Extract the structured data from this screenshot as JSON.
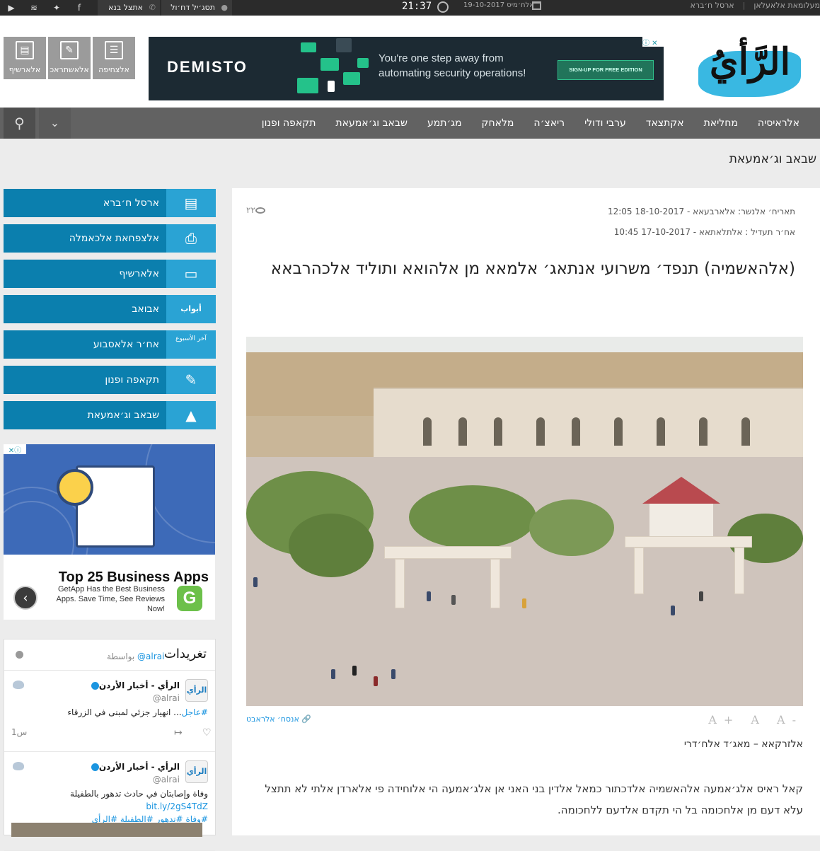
{
  "topbar": {
    "social_icons": [
      "youtube-icon",
      "rss-icon",
      "twitter-icon",
      "facebook-icon"
    ],
    "contact_label": "אתצל בנא",
    "login_label": "תסג׳יל דח׳ול",
    "time": "21:37",
    "date": "אלח׳מיס 19-10-2017",
    "links": [
      "ארסל ח׳ברא",
      "מעלומאת אלאעלאן"
    ]
  },
  "header": {
    "quick_links": [
      "אלצחיפה",
      "אלאשתראכ",
      "אלארשיף"
    ],
    "logo_text": "الرَّأيُ",
    "ad": {
      "brand": "DEMISTO",
      "message_line1": "You're one step away from",
      "message_line2": "automating security operations!",
      "cta": "SIGN-UP FOR FREE EDITION"
    }
  },
  "nav": {
    "items": [
      "אלראיסיה",
      "מחליאת",
      "אקתצאד",
      "ערבי ודולי",
      "ריאצ׳ה",
      "מלאחק",
      "מג׳תמע",
      "שבאב וג׳אמעאת",
      "תקאפה ופנון"
    ]
  },
  "section": {
    "title": "שבאב וג׳אמעאת"
  },
  "sidebar": {
    "items": [
      {
        "label": "ארסל ח׳ברא",
        "icon": "newspaper-icon"
      },
      {
        "label": "אלצפחאת אלכאמלה",
        "icon": "pdf-icon"
      },
      {
        "label": "אלארשיף",
        "icon": "archive-icon"
      },
      {
        "label": "אבואב",
        "icon": "abwab-icon",
        "badge": "أبواب"
      },
      {
        "label": "אח׳ר אלאסבוע",
        "icon": "week-icon",
        "badge": "آخر الأسبوع"
      },
      {
        "label": "תקאפה ופנון",
        "icon": "culture-icon"
      },
      {
        "label": "שבאב וג׳אמעאת",
        "icon": "graduation-cap-icon"
      }
    ]
  },
  "side_ad": {
    "headline": "Top 25 Business Apps",
    "sub": "GetApp Has the Best Business Apps. Save Time, See Reviews Now!",
    "logo_letter": "G"
  },
  "tweets": {
    "title": "تغريدات",
    "by_label": "بواسطة",
    "by_handle": "@alrai",
    "items": [
      {
        "name": "الرأي - أخبار الأردن",
        "handle": "@alrai",
        "avatar": "الرأي",
        "text_tag": "#عاجل",
        "text": "... انهيار جزئي لمبنى في الزرقاء",
        "time": "1س"
      },
      {
        "name": "الرأي - أخبار الأردن",
        "handle": "@alrai",
        "avatar": "الرأي",
        "text": "وفاة وإصابتان في حادث تدهور بالطفيلة",
        "link": "bit.ly/2gS4TdZ",
        "tags": "#وفاة #تدهور #الطفيلة #الرأي"
      }
    ]
  },
  "article": {
    "published": "תאריח׳ אלנשר: אלארבעאא - 18-10-2017 12:05",
    "updated": "אח׳ר תעדיל : אלתלאתאא - 17-10-2017 10:45",
    "views": "٢٢",
    "headline": "(אלהאשמיה) תנפד׳ משרועי אנתאג׳ אלמאא מן אלהואא ותוליד אלכהרבאא",
    "photo_credit": "אנסח׳ אלראבט",
    "font_sizes": [
      "A+",
      "A",
      "A-"
    ],
    "byline": "אלזרקאא – מאג׳ד אלח׳דרי",
    "body": "קאל ראיס אלג׳אמעה אלהאשמיה אלדכתור כמאל אלדין בני האני אן אלג׳אמעה הי אלוחידה פי אלארדן אלתי לא תתצל עלא דעם מן אלחכומה בל הי תקדם אלדעם ללחכומה."
  }
}
